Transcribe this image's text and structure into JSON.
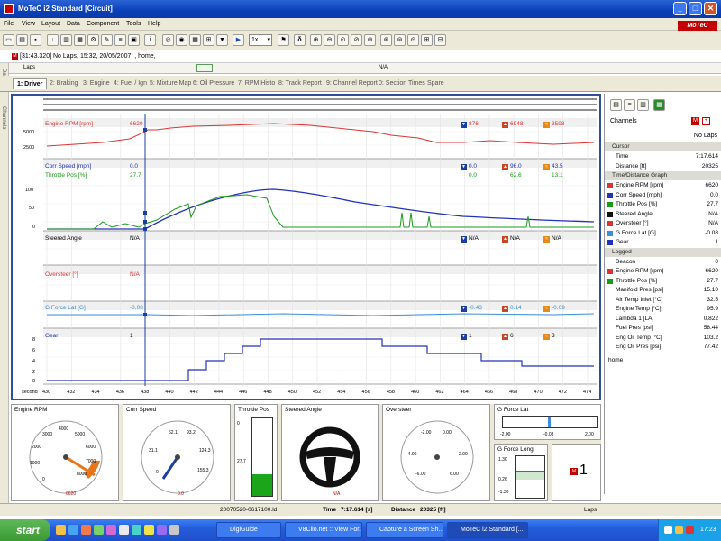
{
  "window": {
    "title": "MoTeC i2 Standard [Circuit]",
    "brand": "MoTeC"
  },
  "menu": [
    "File",
    "View",
    "Layout",
    "Data",
    "Component",
    "Tools",
    "Help"
  ],
  "toolbar": {
    "zoom": "1x"
  },
  "info": {
    "text": "[31:43.320] No Laps, 15:32, 20/05/2007, , home,",
    "laps_label": "Laps",
    "na": "N/A"
  },
  "tabs": [
    "1: Driver",
    "2: Braking",
    "3: Engine",
    "4: Fuel / Ign",
    "5: Mixture Map",
    "6: Oil Pressure",
    "7: RPM Histo",
    "8: Track Report",
    "9: Channel Report",
    "0: Section Times",
    "Spare"
  ],
  "left_labels": [
    "Data",
    "Channels"
  ],
  "graph": {
    "xlabel": "second",
    "xticks": [
      "430",
      "432",
      "434",
      "436",
      "438",
      "440",
      "442",
      "444",
      "446",
      "448",
      "450",
      "452",
      "454",
      "456",
      "458",
      "460",
      "462",
      "464",
      "466",
      "468",
      "470",
      "472",
      "474"
    ],
    "rows": [
      {
        "name": "Engine RPM [rpm]",
        "cursor": "6620",
        "min": "876",
        "max": "6948",
        "avg": "3598",
        "color": "#d33"
      },
      {
        "name": "Corr Speed [mph]",
        "cursor": "0.0",
        "min": "0.0",
        "max": "96.0",
        "avg": "43.5",
        "color": "#2233bb"
      },
      {
        "name": "Throttle Pos [%]",
        "cursor": "27.7",
        "min": "0.0",
        "max": "62.6",
        "avg": "13.1",
        "color": "#1a9a1a"
      },
      {
        "name": "Steered Angle",
        "cursor": "N/A",
        "min": "N/A",
        "max": "N/A",
        "avg": "N/A",
        "color": "#111"
      },
      {
        "name": "Oversteer [°]",
        "cursor": "N/A",
        "color": "#d33"
      },
      {
        "name": "G Force Lat [G]",
        "cursor": "-0.08",
        "min": "-0.43",
        "max": "0.14",
        "avg": "-0.09",
        "color": "#3b8fd8"
      },
      {
        "name": "Gear",
        "cursor": "1",
        "min": "1",
        "max": "6",
        "avg": "3",
        "color": "#2233bb"
      }
    ],
    "rpm_ticks": [
      "5000",
      "2500"
    ],
    "speed_ticks": [
      "100",
      "50",
      "0"
    ],
    "gear_ticks": [
      "8",
      "6",
      "4",
      "2",
      "0"
    ],
    "cursor_x": "437.5"
  },
  "channels": {
    "title": "Channels",
    "laps": "No Laps",
    "cursor_section": "Cursor",
    "cursor_rows": [
      {
        "name": "Time",
        "value": "7:17.614"
      },
      {
        "name": "Distance [ft]",
        "value": "20325"
      }
    ],
    "graph_section": "Time/Distance Graph",
    "graph_rows": [
      {
        "name": "Engine RPM [rpm]",
        "value": "6620",
        "color": "#d33"
      },
      {
        "name": "Corr Speed [mph]",
        "value": "0.0",
        "color": "#2233bb"
      },
      {
        "name": "Throttle Pos [%]",
        "value": "27.7",
        "color": "#1a9a1a"
      },
      {
        "name": "Steered Angle",
        "value": "N/A",
        "color": "#111"
      },
      {
        "name": "Oversteer [°]",
        "value": "N/A",
        "color": "#d33"
      },
      {
        "name": "G Force Lat [G]",
        "value": "-0.08",
        "color": "#3b8fd8"
      },
      {
        "name": "Gear",
        "value": "1",
        "color": "#2233bb"
      }
    ],
    "logged_section": "Logged",
    "logged_rows": [
      {
        "name": "Beacon",
        "value": "0",
        "color": ""
      },
      {
        "name": "Engine RPM [rpm]",
        "value": "6620",
        "color": "#d33"
      },
      {
        "name": "Throttle Pos [%]",
        "value": "27.7",
        "color": "#1a9a1a"
      },
      {
        "name": "Manifold Pres [psi]",
        "value": "15.10",
        "color": ""
      },
      {
        "name": "Air Temp Inlet [°C]",
        "value": "32.5",
        "color": ""
      },
      {
        "name": "Engine Temp [°C]",
        "value": "95.9",
        "color": ""
      },
      {
        "name": "Lambda 1 [LA]",
        "value": "0.822",
        "color": ""
      },
      {
        "name": "Fuel Pres [psi]",
        "value": "58.44",
        "color": ""
      },
      {
        "name": "Eng Oil Temp [°C]",
        "value": "103.2",
        "color": ""
      },
      {
        "name": "Eng Oil Pres [psi]",
        "value": "77.42",
        "color": ""
      }
    ],
    "footer": "home"
  },
  "gauges": {
    "rpm": {
      "label": "Engine RPM",
      "value": "6620",
      "ticks": [
        "0",
        "1000",
        "2000",
        "3000",
        "4000",
        "5000",
        "6000",
        "7000",
        "8000"
      ]
    },
    "speed": {
      "label": "Corr Speed",
      "value": "0.0",
      "ticks": [
        "62.1",
        "93.2",
        "31.1",
        "124.3",
        "0",
        "155.3"
      ]
    },
    "throttle": {
      "label": "Throttle Pos",
      "value": "27.7",
      "tick_top": "0",
      "fill_pct": 27.7
    },
    "steer": {
      "label": "Steered Angle",
      "value": "N/A"
    },
    "oversteer": {
      "label": "Oversteer",
      "ticks": [
        "-2.00",
        "0.00",
        "-4.00",
        "2.00",
        "-6.00",
        "6.00"
      ]
    },
    "glat": {
      "label": "G Force Lat",
      "left": "-2.00",
      "mid": "-0.08",
      "right": "2.00"
    },
    "glong": {
      "label": "G Force Long",
      "t1": "1.30",
      "t2": "0.26",
      "t3": "-1.30"
    },
    "gear": {
      "value": "1"
    }
  },
  "status": {
    "file": "20070520-0617100.ld",
    "time_label": "Time",
    "time": "7:17.614 [s]",
    "dist_label": "Distance",
    "dist": "20325 [ft]",
    "laps": "Laps"
  },
  "taskbar": {
    "start": "start",
    "tasks": [
      "DigiGuide",
      "V8Clio.net :: View For...",
      "Capture a Screen Sh...",
      "MoTeC i2 Standard [..."
    ],
    "clock": "17:23"
  }
}
